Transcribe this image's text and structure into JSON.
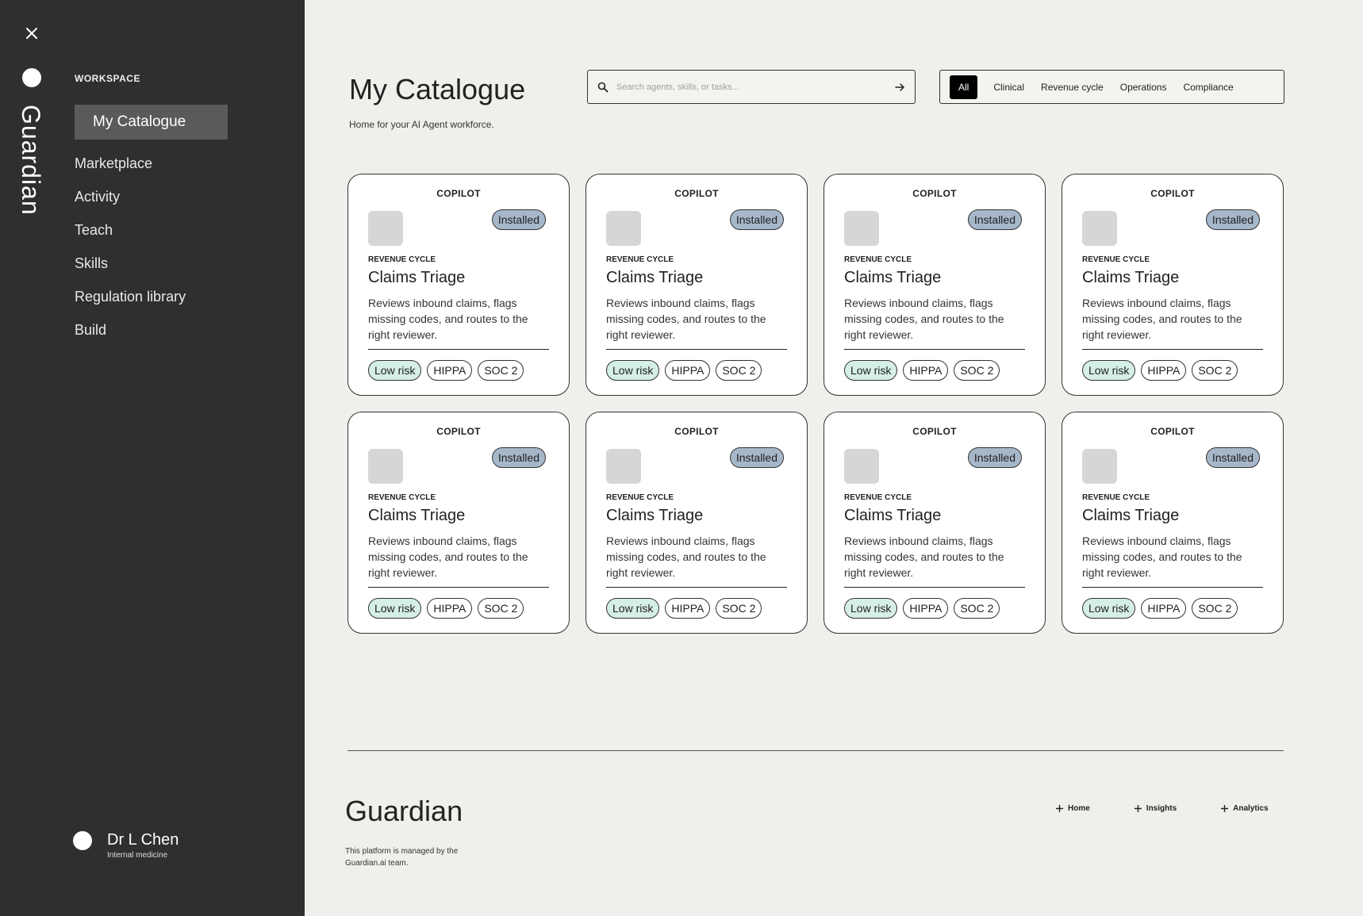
{
  "sidebar": {
    "brand": "Guardian",
    "section_label": "WORKSPACE",
    "items": [
      {
        "label": "My Catalogue",
        "active": true
      },
      {
        "label": "Marketplace"
      },
      {
        "label": "Activity"
      },
      {
        "label": "Teach"
      },
      {
        "label": "Skills"
      },
      {
        "label": "Regulation library"
      },
      {
        "label": "Build"
      }
    ],
    "user": {
      "name": "Dr L Chen",
      "role": "Internal medicine"
    }
  },
  "header": {
    "title": "My Catalogue",
    "subtitle": "Home for your AI Agent workforce."
  },
  "search": {
    "placeholder": "Search agents, skills, or tasks..."
  },
  "filters": [
    "All",
    "Clinical",
    "Revenue cycle",
    "Operations",
    "Compliance"
  ],
  "cards": [
    {
      "type": "COPILOT",
      "status": "Installed",
      "category": "REVENUE CYCLE",
      "title": "Claims Triage",
      "description": "Reviews inbound claims, flags missing codes, and routes to the right reviewer.",
      "tags": [
        "Low risk",
        "HIPPA",
        "SOC 2"
      ]
    },
    {
      "type": "COPILOT",
      "status": "Installed",
      "category": "REVENUE CYCLE",
      "title": "Claims Triage",
      "description": "Reviews inbound claims, flags missing codes, and routes to the right reviewer.",
      "tags": [
        "Low risk",
        "HIPPA",
        "SOC 2"
      ]
    },
    {
      "type": "COPILOT",
      "status": "Installed",
      "category": "REVENUE CYCLE",
      "title": "Claims Triage",
      "description": "Reviews inbound claims, flags missing codes, and routes to the right reviewer.",
      "tags": [
        "Low risk",
        "HIPPA",
        "SOC 2"
      ]
    },
    {
      "type": "COPILOT",
      "status": "Installed",
      "category": "REVENUE CYCLE",
      "title": "Claims Triage",
      "description": "Reviews inbound claims, flags missing codes, and routes to the right reviewer.",
      "tags": [
        "Low risk",
        "HIPPA",
        "SOC 2"
      ]
    },
    {
      "type": "COPILOT",
      "status": "Installed",
      "category": "REVENUE CYCLE",
      "title": "Claims Triage",
      "description": "Reviews inbound claims, flags missing codes, and routes to the right reviewer.",
      "tags": [
        "Low risk",
        "HIPPA",
        "SOC 2"
      ]
    },
    {
      "type": "COPILOT",
      "status": "Installed",
      "category": "REVENUE CYCLE",
      "title": "Claims Triage",
      "description": "Reviews inbound claims, flags missing codes, and routes to the right reviewer.",
      "tags": [
        "Low risk",
        "HIPPA",
        "SOC 2"
      ]
    },
    {
      "type": "COPILOT",
      "status": "Installed",
      "category": "REVENUE CYCLE",
      "title": "Claims Triage",
      "description": "Reviews inbound claims, flags missing codes, and routes to the right reviewer.",
      "tags": [
        "Low risk",
        "HIPPA",
        "SOC 2"
      ]
    },
    {
      "type": "COPILOT",
      "status": "Installed",
      "category": "REVENUE CYCLE",
      "title": "Claims Triage",
      "description": "Reviews inbound claims, flags missing codes, and routes to the right reviewer.",
      "tags": [
        "Low risk",
        "HIPPA",
        "SOC 2"
      ]
    }
  ],
  "footer": {
    "brand": "Guardian",
    "note": "This platform is managed by the Guardian.ai team.",
    "links": [
      "Home",
      "Insights",
      "Analytics"
    ]
  },
  "colors": {
    "sidebar_bg": "#2f2f2f",
    "page_bg": "#f0efeb",
    "installed_badge": "#a6b7ca",
    "low_risk_tag": "#d5eee6",
    "active_filter": "#000000"
  },
  "icons": {
    "close": "close-icon",
    "search": "search-icon",
    "submit": "arrow-right-icon",
    "footer_link": "plus-icon"
  }
}
